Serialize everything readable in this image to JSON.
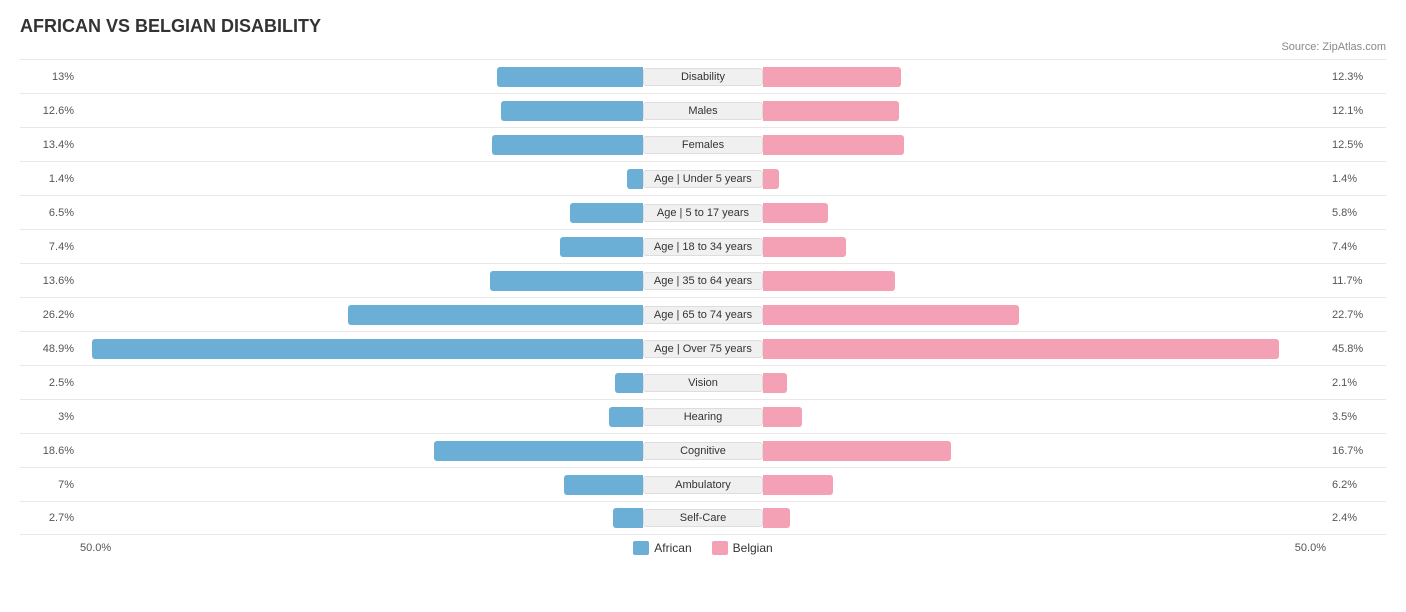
{
  "title": "AFRICAN VS BELGIAN DISABILITY",
  "source": "Source: ZipAtlas.com",
  "footer": {
    "left_scale": "50.0%",
    "right_scale": "50.0%"
  },
  "legend": {
    "african_label": "African",
    "belgian_label": "Belgian"
  },
  "maxValue": 50,
  "rows": [
    {
      "label": "Disability",
      "african": 13.0,
      "belgian": 12.3
    },
    {
      "label": "Males",
      "african": 12.6,
      "belgian": 12.1
    },
    {
      "label": "Females",
      "african": 13.4,
      "belgian": 12.5
    },
    {
      "label": "Age | Under 5 years",
      "african": 1.4,
      "belgian": 1.4
    },
    {
      "label": "Age | 5 to 17 years",
      "african": 6.5,
      "belgian": 5.8
    },
    {
      "label": "Age | 18 to 34 years",
      "african": 7.4,
      "belgian": 7.4
    },
    {
      "label": "Age | 35 to 64 years",
      "african": 13.6,
      "belgian": 11.7
    },
    {
      "label": "Age | 65 to 74 years",
      "african": 26.2,
      "belgian": 22.7
    },
    {
      "label": "Age | Over 75 years",
      "african": 48.9,
      "belgian": 45.8
    },
    {
      "label": "Vision",
      "african": 2.5,
      "belgian": 2.1
    },
    {
      "label": "Hearing",
      "african": 3.0,
      "belgian": 3.5
    },
    {
      "label": "Cognitive",
      "african": 18.6,
      "belgian": 16.7
    },
    {
      "label": "Ambulatory",
      "african": 7.0,
      "belgian": 6.2
    },
    {
      "label": "Self-Care",
      "african": 2.7,
      "belgian": 2.4
    }
  ]
}
